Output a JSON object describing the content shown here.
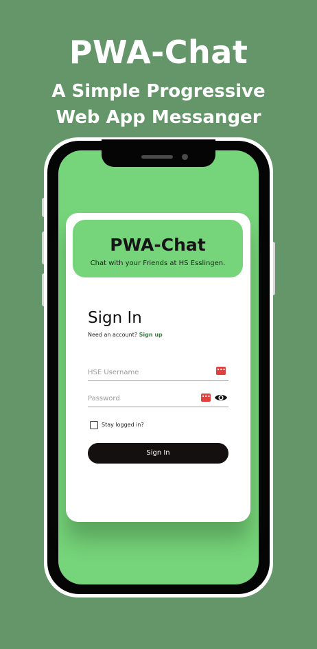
{
  "promo": {
    "title": "PWA-Chat",
    "subtitle": "A Simple Progressive Web App Messanger"
  },
  "login_card": {
    "app_name": "PWA-Chat",
    "tagline": "Chat with your Friends at HS Esslingen.",
    "heading": "Sign In",
    "account_prompt": "Need an account?",
    "signup_link": "Sign up",
    "username_placeholder": "HSE Username",
    "username_value": "",
    "password_placeholder": "Password",
    "password_value": "",
    "stay_logged_in_label": "Stay logged in?",
    "stay_logged_in_checked": false,
    "signin_button": "Sign In",
    "icons": {
      "password_manager": "password-manager-icon",
      "reveal_password": "eye-icon"
    }
  },
  "colors": {
    "background": "#659669",
    "accent_green": "#76d47a",
    "button_dark": "#141010",
    "link_green": "#3e7a43",
    "password_manager_red": "#e0413c"
  }
}
